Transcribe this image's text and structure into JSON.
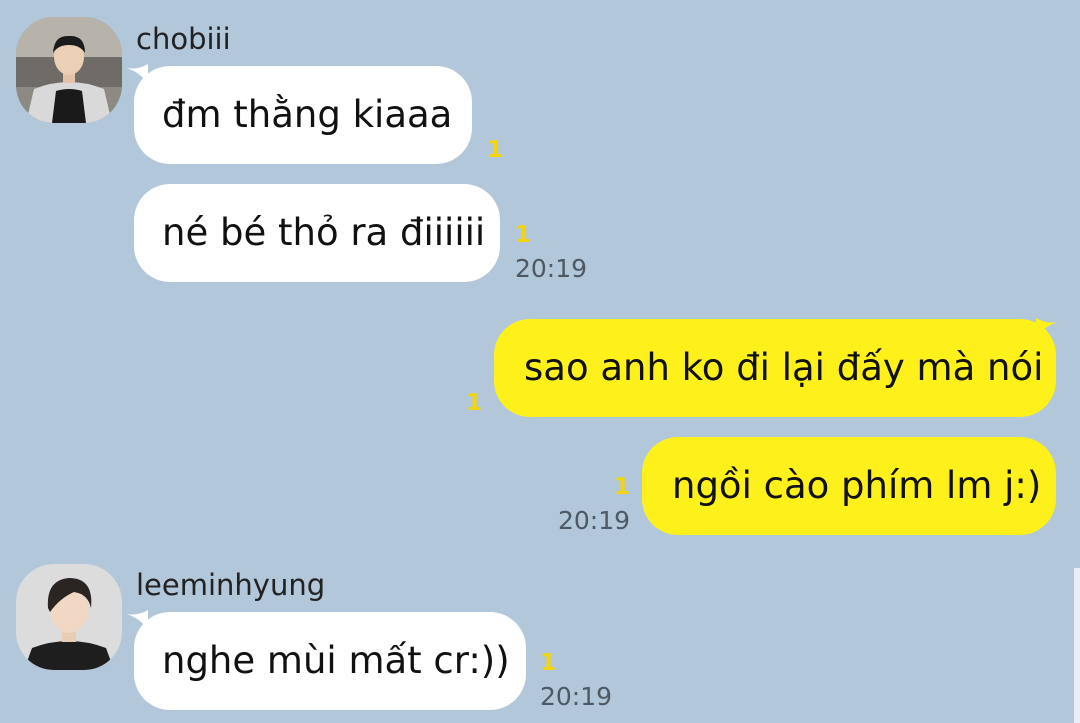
{
  "theme": {
    "background": "#b2c7da",
    "incoming_bubble": "#ffffff",
    "outgoing_bubble": "#fef01b",
    "unread_color": "#f2d50a",
    "time_color": "#4d5964"
  },
  "chat": {
    "groups": [
      {
        "sender": "chobiii",
        "avatar": "user-avatar-photo",
        "messages": [
          {
            "text": "đm thằng kiaaa",
            "unread": "1",
            "time": ""
          },
          {
            "text": "né bé thỏ ra điiiiii",
            "unread": "1",
            "time": "20:19"
          }
        ]
      },
      {
        "sender": "",
        "outgoing": true,
        "messages": [
          {
            "text": "sao anh ko đi lại đấy mà nói",
            "unread": "1",
            "time": ""
          },
          {
            "text": "ngồi cào phím lm j:)",
            "unread": "1",
            "time": "20:19"
          }
        ]
      },
      {
        "sender": "leeminhyung",
        "avatar": "user-avatar-photo",
        "messages": [
          {
            "text": "nghe mùi mất cr:))",
            "unread": "1",
            "time": "20:19"
          }
        ]
      }
    ]
  }
}
